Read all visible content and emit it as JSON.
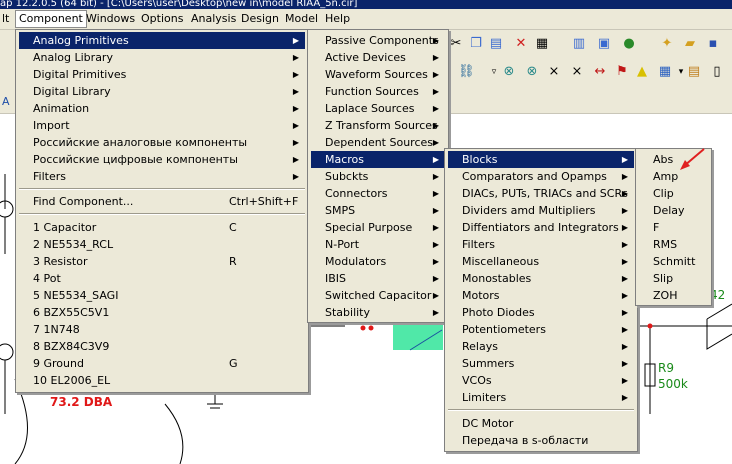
{
  "window": {
    "title": "ap 12.2.0.5 (64 bit) - [C:\\Users\\user\\Desktop\\new in\\model RIAA_5n.cir]"
  },
  "menubar": {
    "items": [
      "lt",
      "Component",
      "Windows",
      "Options",
      "Analysis",
      "Design",
      "Model",
      "Help"
    ]
  },
  "component_menu": {
    "items": [
      {
        "label": "Analog Primitives",
        "arrow": "▶"
      },
      {
        "label": "Analog Library",
        "arrow": "▶"
      },
      {
        "label": "Digital Primitives",
        "arrow": "▶"
      },
      {
        "label": "Digital Library",
        "arrow": "▶"
      },
      {
        "label": "Animation",
        "arrow": "▶"
      },
      {
        "label": "Import",
        "arrow": "▶"
      },
      {
        "label": "Российские аналоговые компоненты",
        "arrow": "▶"
      },
      {
        "label": "Российские цифровые компоненты",
        "arrow": "▶"
      },
      {
        "label": "Filters",
        "arrow": "▶"
      }
    ],
    "find": {
      "label": "Find Component...",
      "shortcut": "Ctrl+Shift+F"
    },
    "recent": [
      {
        "label": "1 Capacitor",
        "shortcut": "C"
      },
      {
        "label": "2 NE5534_RCL",
        "shortcut": ""
      },
      {
        "label": "3 Resistor",
        "shortcut": "R"
      },
      {
        "label": "4 Pot",
        "shortcut": ""
      },
      {
        "label": "5 NE5534_SAGI",
        "shortcut": ""
      },
      {
        "label": "6 BZX55C5V1",
        "shortcut": ""
      },
      {
        "label": "7 1N748",
        "shortcut": ""
      },
      {
        "label": "8 BZX84C3V9",
        "shortcut": ""
      },
      {
        "label": "9 Ground",
        "shortcut": "G"
      },
      {
        "label": "10 EL2006_EL",
        "shortcut": ""
      }
    ]
  },
  "analog_primitives_menu": {
    "items": [
      "Passive Components",
      "Active Devices",
      "Waveform Sources",
      "Function Sources",
      "Laplace Sources",
      "Z Transform Sources",
      "Dependent Sources",
      "Macros",
      "Subckts",
      "Connectors",
      "SMPS",
      "Special Purpose",
      "N-Port",
      "Modulators",
      "IBIS",
      "Switched Capacitor",
      "Stability"
    ]
  },
  "macros_menu": {
    "items": [
      "Blocks",
      "Comparators and Opamps",
      "DIACs, PUTs, TRIACs and SCRs",
      "Dividers amd Multipliers",
      "Diffentiators and Integrators",
      "Filters",
      "Miscellaneous",
      "Monostables",
      "Motors",
      "Photo Diodes",
      "Potentiometers",
      "Relays",
      "Summers",
      "VCOs",
      "Limiters"
    ],
    "extra": [
      "DC Motor",
      "Передача в s-области"
    ]
  },
  "blocks_menu": {
    "items": [
      "Abs",
      "Amp",
      "Clip",
      "Delay",
      "F",
      "RMS",
      "Schmitt",
      "Slip",
      "ZOH"
    ]
  },
  "schematic": {
    "dba_label": "73.2 DBA",
    "r9_label": "R9",
    "r9_value": "500k",
    "partial_label": "42"
  },
  "colors": {
    "highlight": "#0a246a",
    "menu_bg": "#ece9d8",
    "dba": "#e01818",
    "green_text": "#1a8a1a",
    "annotation_arrow": "#e02020"
  }
}
